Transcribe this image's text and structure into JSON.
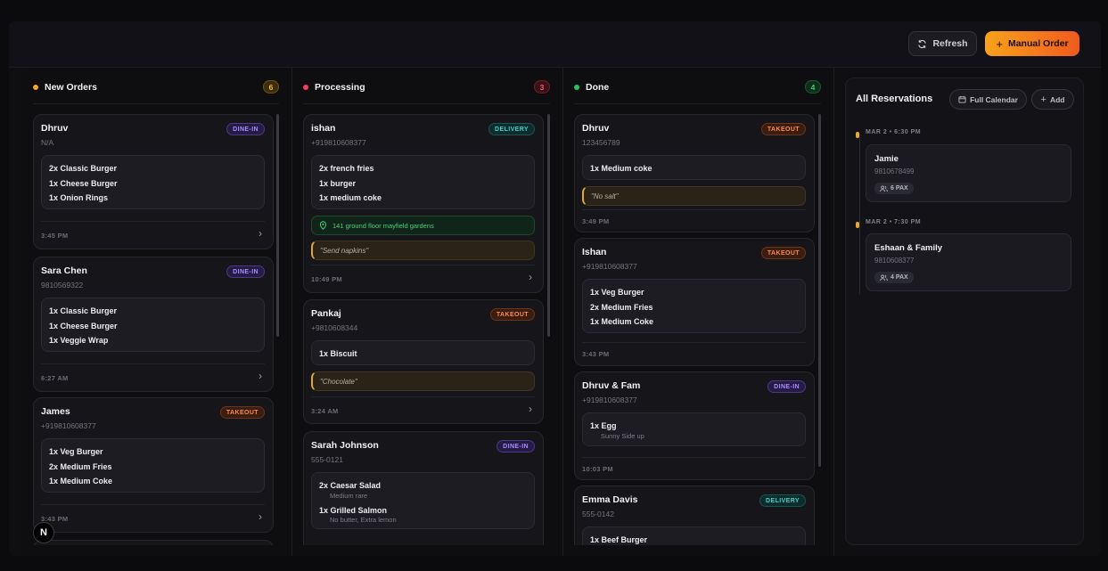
{
  "header": {
    "refresh_label": "Refresh",
    "manual_order_label": "Manual Order"
  },
  "columns": [
    {
      "title": "New Orders",
      "count": "6",
      "dot_color": "#f5a524"
    },
    {
      "title": "Processing",
      "count": "3",
      "dot_color": "#f43f5e"
    },
    {
      "title": "Done",
      "count": "4",
      "dot_color": "#22c55e"
    }
  ],
  "orders": {
    "new": [
      {
        "name": "Dhruv",
        "phone": "N/A",
        "type": "DINE-IN",
        "items": [
          "2x Classic Burger",
          "1x Cheese Burger",
          "1x Onion Rings"
        ],
        "time": "3:45 PM"
      },
      {
        "name": "Sara Chen",
        "phone": "9810569322",
        "type": "DINE-IN",
        "items": [
          "1x Classic Burger",
          "1x Cheese Burger",
          "1x Veggie Wrap"
        ],
        "time": "6:27 AM"
      },
      {
        "name": "James",
        "phone": "+919810608377",
        "type": "TAKEOUT",
        "items": [
          "1x Veg Burger",
          "2x Medium Fries",
          "1x Medium Coke"
        ],
        "time": "3:43 PM"
      }
    ],
    "processing": [
      {
        "name": "ishan",
        "phone": "+919810608377",
        "type": "DELIVERY",
        "items": [
          "2x french fries",
          "1x burger",
          "1x medium coke"
        ],
        "address": "141 ground floor mayfield gardens",
        "note": "\"Send napkins\"",
        "time": "10:49 PM"
      },
      {
        "name": "Pankaj",
        "phone": "+9810608344",
        "type": "TAKEOUT",
        "items": [
          "1x Biscuit"
        ],
        "note": "\"Chocolate\"",
        "time": "3:24 AM"
      },
      {
        "name": "Sarah Johnson",
        "phone": "555-0121",
        "type": "DINE-IN",
        "items": [
          {
            "name": "2x Caesar Salad",
            "note": "Medium rare"
          },
          {
            "name": "1x Grilled Salmon",
            "note": "No butter, Extra lemon"
          }
        ]
      }
    ],
    "done": [
      {
        "name": "Dhruv",
        "phone": "123456789",
        "type": "TAKEOUT",
        "items": [
          "1x Medium coke"
        ],
        "note": "\"No salt\"",
        "time": "3:49 PM"
      },
      {
        "name": "Ishan",
        "phone": "+919810608377",
        "type": "TAKEOUT",
        "items": [
          "1x Veg Burger",
          "2x Medium Fries",
          "1x Medium Coke"
        ],
        "time": "3:43 PM"
      },
      {
        "name": "Dhruv & Fam",
        "phone": "+919810608377",
        "type": "DINE-IN",
        "items": [
          {
            "name": "1x Egg",
            "note": "Sunny Side up"
          }
        ],
        "time": "10:03 PM"
      },
      {
        "name": "Emma Davis",
        "phone": "555-0142",
        "type": "DELIVERY",
        "items": [
          "1x Beef Burger"
        ]
      }
    ]
  },
  "reservations": {
    "title": "All Reservations",
    "full_calendar_label": "Full Calendar",
    "add_label": "Add",
    "entries": [
      {
        "time": "MAR 2 • 6:30 PM",
        "name": "Jamie",
        "phone": "9810678499",
        "pax": "6 PAX"
      },
      {
        "time": "MAR 2 • 7:30 PM",
        "name": "Eshaan & Family",
        "phone": "9810608377",
        "pax": "4 PAX"
      }
    ]
  },
  "colors": {
    "dine_in": "#a88bff",
    "takeout": "#ff8a4a",
    "delivery": "#3fd1c6",
    "accent": "#f9a21b"
  },
  "logo_letter": "N"
}
